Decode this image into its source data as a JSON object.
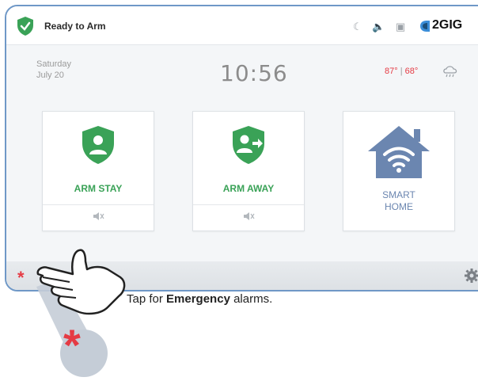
{
  "status": {
    "text": "Ready to Arm",
    "brand": "2GIG",
    "icons": [
      "moon-icon",
      "speaker-icon",
      "camera-icon",
      "brand-logo-icon"
    ]
  },
  "info": {
    "day": "Saturday",
    "date": "July 20",
    "time": "10:56",
    "temp_high": "87°",
    "temp_separator": "|",
    "temp_low": "68°",
    "weather_icon": "cloud-rain-icon"
  },
  "tiles": [
    {
      "label": "ARM STAY",
      "icon": "arm-stay-shield-icon",
      "sub_icon": "mute-icon"
    },
    {
      "label": "ARM AWAY",
      "icon": "arm-away-shield-icon",
      "sub_icon": "mute-icon"
    },
    {
      "label_line1": "SMART",
      "label_line2": "HOME",
      "icon": "smart-home-icon"
    }
  ],
  "bottom": {
    "emergency_icon": "*",
    "settings_icon": "gear-icon"
  },
  "callout": {
    "prefix": "Tap for ",
    "bold": "Emergency",
    "suffix": " alarms.",
    "star": "*"
  },
  "colors": {
    "accent_green": "#3aa257",
    "alarm_red": "#e53b44",
    "home_blue": "#6b86b0",
    "frame_blue": "#6f98c7"
  }
}
